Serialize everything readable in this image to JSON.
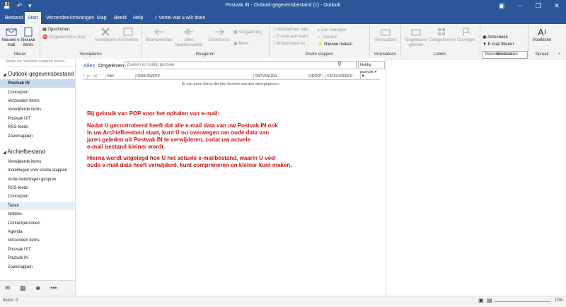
{
  "title": "Postvak IN - Outlook-gegevensbestand (1)  -  Outlook",
  "tabs": [
    "Bestand",
    "Start",
    "Verzenden/ontvangen",
    "Map",
    "Beeld",
    "Help"
  ],
  "tell_me": "Vertel wat u wilt doen",
  "ribbon": {
    "new_email": "Nieuwe e-mail",
    "new_items": "Nieuwe items",
    "group_new": "Nieuw",
    "cleanup": "Opschonen",
    "junk": "Ongewenste e-mail",
    "delete": "Verwijderen",
    "archive": "Archiveren",
    "group_delete": "Verwijderen",
    "reply": "Beantwoorden",
    "reply_all": "Allen beantwoorden",
    "forward": "Doorsturen",
    "meeting": "Vergadering",
    "more": "Meer",
    "group_respond": "Reageren",
    "qs1": "Verplaatsen naa...",
    "qs2": "E-mail aan team",
    "qs3": "Antwoorden en...",
    "qs4": "Aan manager",
    "qs5": "Gereed",
    "qs6": "Nieuwe maken",
    "group_quick": "Snelle stappen",
    "move": "Verplaatsen",
    "group_move": "Verplaatsen",
    "unread": "Ongelezen/ gelezen",
    "categorize": "Categoriseren",
    "followup": "Opvolgen",
    "group_tags": "Labels",
    "people_search": "Personen zoeken",
    "address_book": "Adresboek",
    "filter_email": "E-mail filteren",
    "group_find": "Zoeken",
    "read_aloud": "Voorlezen",
    "group_speech": "Spraak"
  },
  "leftpane": {
    "search_hint": "Sleep uw favoriete mappen hierna",
    "account1": "Outlook-gegevensbestand",
    "folders1": [
      "Postvak IN",
      "Concepten",
      "Verzonden items",
      "Verwijderde items",
      "Postvak UIT",
      "RSS-feeds",
      "Zoekmappen"
    ],
    "account2": "Archiefbestand",
    "folders2": [
      "Verwijderde items",
      "Instellingen voor snelle stappen",
      "Actie-instellingen gesprek",
      "RSS-feeds",
      "Concepten",
      "Taken",
      "Notities",
      "Contactpersonen",
      "Agenda",
      "Verzonden items",
      "Postvak UIT",
      "Postvak IN",
      "Zoekmappen"
    ]
  },
  "list": {
    "filter_all": "Alles",
    "filter_unread": "Ongelezen",
    "search_placeholder": "Zoeken in Huidig postvak",
    "scope": "Huidig postvak",
    "columns": [
      "VAN",
      "ONDERWERP",
      "ONTVANGEN",
      "GROOT...",
      "CATEGORIEEN"
    ],
    "empty": "Er zijn geen items die hier kunnen worden weergegeven."
  },
  "message": {
    "heading": "Bij gebruik van POP voor het ophalen van e-mail:",
    "p1": [
      "Nadat U gecontroleerd heeft dat alle e-mail data van uw Postvak IN ook",
      "in uw Archiefbestand staat, kunt U nu overwegen om oude data van",
      "jaren geleden uit Postvak IN te verwijderen, zodat uw actuele",
      "e-mail bestand kleiner wordt."
    ],
    "p2": [
      "Hierna wordt uitgelegd hoe U het actuele e-mailbestand, waarin U veel",
      "oude e-mail data heeft verwijderd, kunt comprimeren en kleiner kunt maken."
    ]
  },
  "status": {
    "items": "Items: 0",
    "zoom": "10%"
  }
}
